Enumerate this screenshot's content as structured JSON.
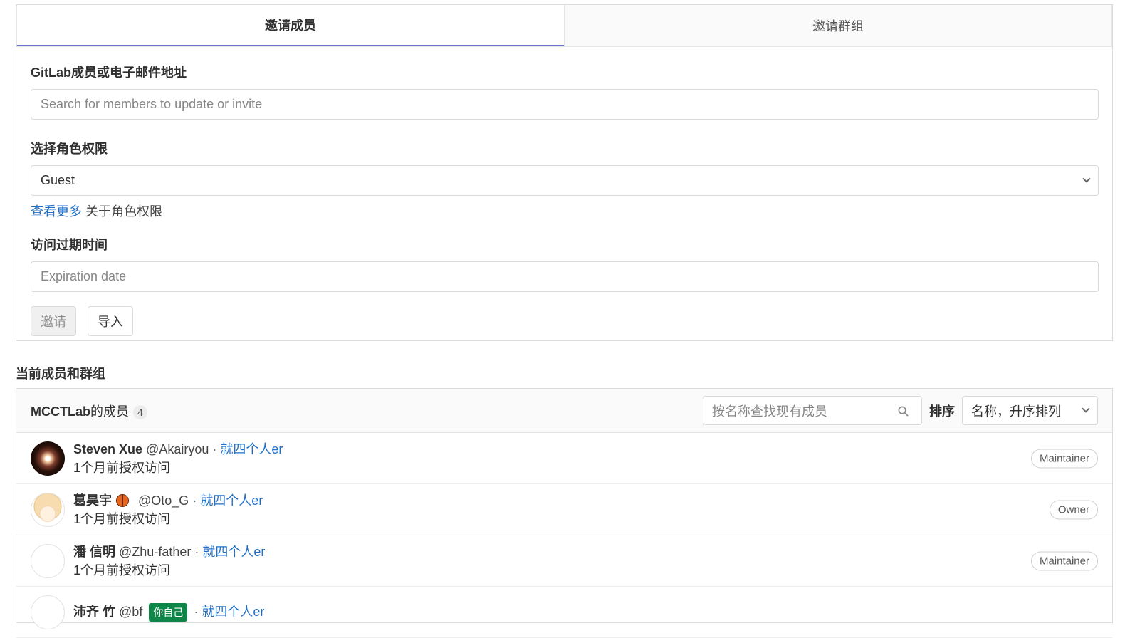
{
  "tabs": [
    {
      "label": "邀请成员",
      "active": true
    },
    {
      "label": "邀请群组",
      "active": false
    }
  ],
  "invite_form": {
    "member_label": "GitLab成员或电子邮件地址",
    "member_placeholder": "Search for members to update or invite",
    "role_label": "选择角色权限",
    "role_value": "Guest",
    "help_link": "查看更多",
    "help_text": " 关于角色权限",
    "expiry_label": "访问过期时间",
    "expiry_placeholder": "Expiration date",
    "invite_button": "邀请",
    "import_button": "导入"
  },
  "members_section": {
    "title": "当前成员和群组",
    "group_name": "MCCTLab",
    "group_suffix": "的成员",
    "count": "4",
    "search_placeholder": "按名称查找现有成员",
    "sort_label": "排序",
    "sort_value": "名称，升序排列",
    "members": [
      {
        "name": "Steven Xue",
        "handle": "@Akairyou",
        "separator": " · ",
        "group": "就四个人er",
        "granted": "1个月前授权访问",
        "role": "Maintainer",
        "avatar": "dark"
      },
      {
        "name": "葛昊宇",
        "handle": "@Oto_G",
        "separator": " · ",
        "group": "就四个人er",
        "granted": "1个月前授权访问",
        "role": "Owner",
        "avatar": "anime",
        "emoji": "basketball"
      },
      {
        "name": "潘 信明",
        "handle": "@Zhu-father",
        "separator": " · ",
        "group": "就四个人er",
        "granted": "1个月前授权访问",
        "role": "Maintainer",
        "avatar": "blank"
      },
      {
        "name": "沛齐 竹",
        "handle": "@bf",
        "you_badge": "你自己",
        "separator": " · ",
        "group": "就四个人er",
        "granted": "",
        "role": "",
        "avatar": "blank"
      }
    ]
  },
  "colors": {
    "link": "#1f6fc9",
    "active_tab_underline": "#6e6fce",
    "you_badge": "#108548"
  }
}
